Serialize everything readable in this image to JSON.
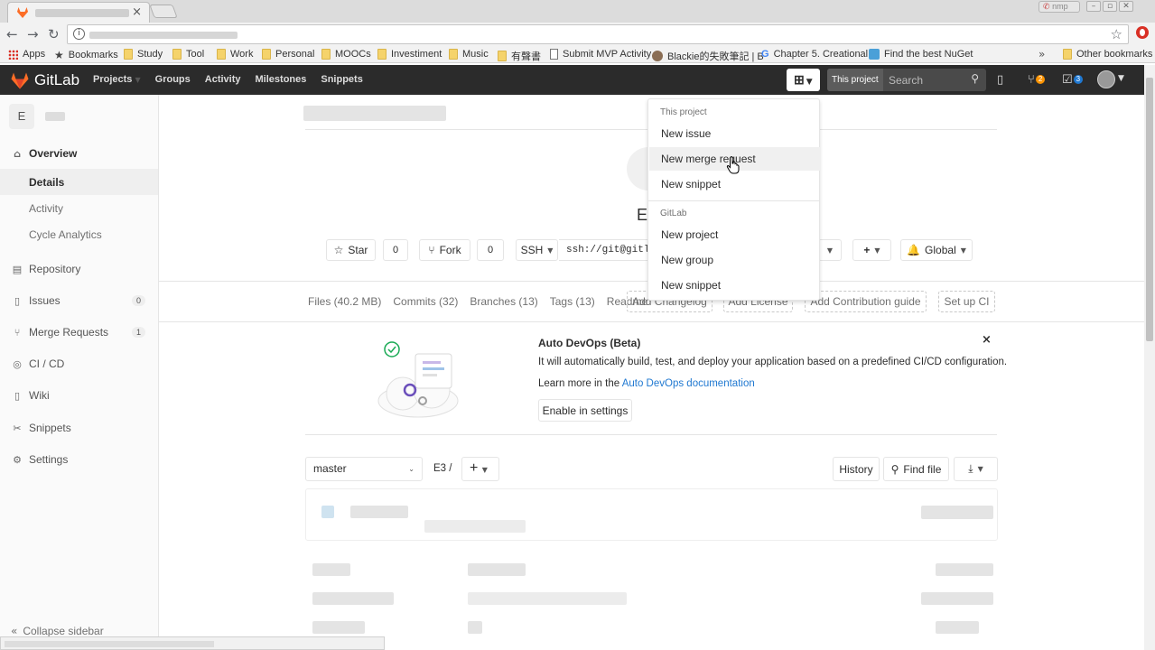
{
  "browser": {
    "tab_close": "×",
    "window_user": "nmp",
    "bookmarks": [
      {
        "label": "Apps",
        "icon": "apps-grid-icon"
      },
      {
        "label": "Bookmarks",
        "icon": "star-icon"
      },
      {
        "label": "Study",
        "icon": "folder-icon"
      },
      {
        "label": "Tool",
        "icon": "folder-icon"
      },
      {
        "label": "Work",
        "icon": "folder-icon"
      },
      {
        "label": "Personal",
        "icon": "folder-icon"
      },
      {
        "label": "MOOCs",
        "icon": "folder-icon"
      },
      {
        "label": "Investiment",
        "icon": "folder-icon"
      },
      {
        "label": "Music",
        "icon": "folder-icon"
      },
      {
        "label": "有聲書",
        "icon": "folder-icon"
      },
      {
        "label": "Submit MVP Activity",
        "icon": "page-icon"
      },
      {
        "label": "Blackie的失敗筆記 | B",
        "icon": "avatar-icon"
      },
      {
        "label": "Chapter 5. Creational",
        "icon": "google-icon"
      },
      {
        "label": "Find the best NuGet",
        "icon": "nuget-icon"
      },
      {
        "label": "Other bookmarks",
        "icon": "folder-icon"
      }
    ],
    "more": "»"
  },
  "header": {
    "brand": "GitLab",
    "nav": [
      "Projects",
      "Groups",
      "Activity",
      "Milestones",
      "Snippets"
    ],
    "search_scope": "This project",
    "search_placeholder": "Search",
    "mr_count": "2",
    "todo_count": "3"
  },
  "sidebar": {
    "project_initial": "E",
    "overview": "Overview",
    "subitems": [
      "Details",
      "Activity",
      "Cycle Analytics"
    ],
    "items": [
      {
        "label": "Repository",
        "count": ""
      },
      {
        "label": "Issues",
        "count": "0"
      },
      {
        "label": "Merge Requests",
        "count": "1"
      },
      {
        "label": "CI / CD",
        "count": ""
      },
      {
        "label": "Wiki",
        "count": ""
      },
      {
        "label": "Snippets",
        "count": ""
      },
      {
        "label": "Settings",
        "count": ""
      }
    ],
    "collapse": "Collapse sidebar"
  },
  "project": {
    "title_visible": "E3",
    "star_label": "Star",
    "star_count": "0",
    "fork_label": "Fork",
    "fork_count": "0",
    "protocol": "SSH",
    "clone_url": "ssh://git@gitla",
    "notify_label": "Global",
    "stats": [
      "Files (40.2 MB)",
      "Commits (32)",
      "Branches (13)",
      "Tags (13)",
      "Readme"
    ],
    "actions": [
      "Add Changelog",
      "Add License",
      "Add Contribution guide",
      "Set up CI"
    ]
  },
  "devops": {
    "title": "Auto DevOps (Beta)",
    "description": "It will automatically build, test, and deploy your application based on a predefined CI/CD configuration.",
    "learn_prefix": "Learn more in the",
    "learn_link": "Auto DevOps documentation",
    "enable_button": "Enable in settings",
    "close": "×"
  },
  "repo": {
    "branch": "master",
    "path": "E3 /",
    "history": "History",
    "find_file": "Find file"
  },
  "dropdown": {
    "section1": "This project",
    "section1_items": [
      "New issue",
      "New merge request",
      "New snippet"
    ],
    "section2": "GitLab",
    "section2_items": [
      "New project",
      "New group",
      "New snippet"
    ],
    "hovered": "New merge request"
  },
  "colors": {
    "header_bg": "#2b2b2b",
    "link": "#1f78d1",
    "mr_badge": "#fc9403",
    "todo_badge": "#1f78d1"
  }
}
